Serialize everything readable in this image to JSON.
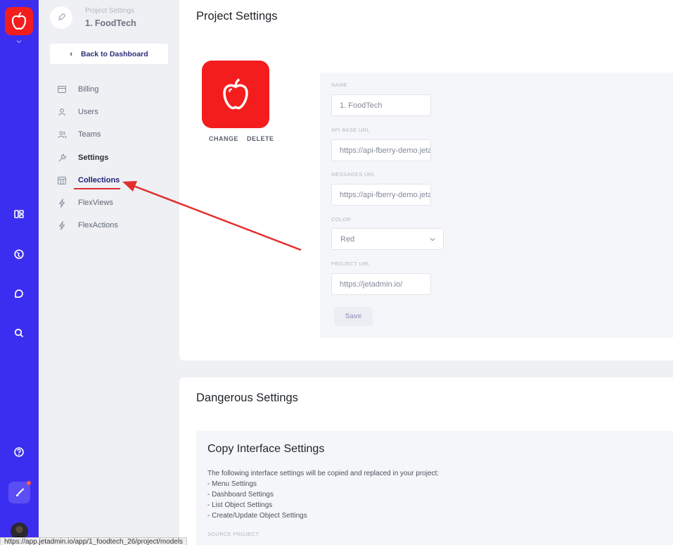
{
  "sidebar": {
    "project_subtitle": "Project Settings",
    "project_name": "1. FoodTech",
    "back_button": "Back to Dashboard",
    "items": [
      {
        "label": "Billing",
        "icon": "credit-card-icon"
      },
      {
        "label": "Users",
        "icon": "user-icon"
      },
      {
        "label": "Teams",
        "icon": "users-icon"
      },
      {
        "label": "Settings",
        "icon": "wrench-icon"
      },
      {
        "label": "Collections",
        "icon": "table-icon"
      },
      {
        "label": "FlexViews",
        "icon": "lightning-icon"
      },
      {
        "label": "FlexActions",
        "icon": "lightning-icon"
      }
    ],
    "active_item": "Collections"
  },
  "rail": {
    "icons": [
      "apple-logo-icon",
      "chevron-down-icon",
      "dashboard-icon",
      "globe-icon",
      "chat-icon",
      "search-icon",
      "help-icon",
      "paint-brush-icon",
      "avatar"
    ]
  },
  "project_settings": {
    "title": "Project Settings",
    "logo_actions": {
      "change": "CHANGE",
      "delete": "DELETE"
    },
    "fields": {
      "name": {
        "label": "NAME",
        "value": "1. FoodTech"
      },
      "api_base_url": {
        "label": "API BASE URL",
        "value": "https://api-fberry-demo.jetadmin.io"
      },
      "messages_url": {
        "label": "MESSAGES URL",
        "value": "https://api-fberry-demo.jetadmin.io"
      },
      "color": {
        "label": "COLOR",
        "value": "Red"
      },
      "project_url": {
        "label": "PROJECT URL",
        "value": "https://jetadmin.io/"
      }
    },
    "save_label": "Save"
  },
  "dangerous_settings": {
    "title": "Dangerous Settings",
    "copy_title": "Copy Interface Settings",
    "copy_intro": "The following interface settings will be copied and replaced in your project:",
    "copy_items": [
      "- Menu Settings",
      "- Dashboard Settings",
      "- List Object Settings",
      "- Create/Update Object Settings"
    ],
    "source_label": "SOURCE PROJECT"
  },
  "status_bar": {
    "url": "https://app.jetadmin.io/app/1_foodtech_26/project/models"
  },
  "colors": {
    "rail": "#3c2ef0",
    "brand_red": "#f41d1d",
    "active_nav": "#1f1f7a",
    "annotation_arrow": "#e22e2e"
  }
}
